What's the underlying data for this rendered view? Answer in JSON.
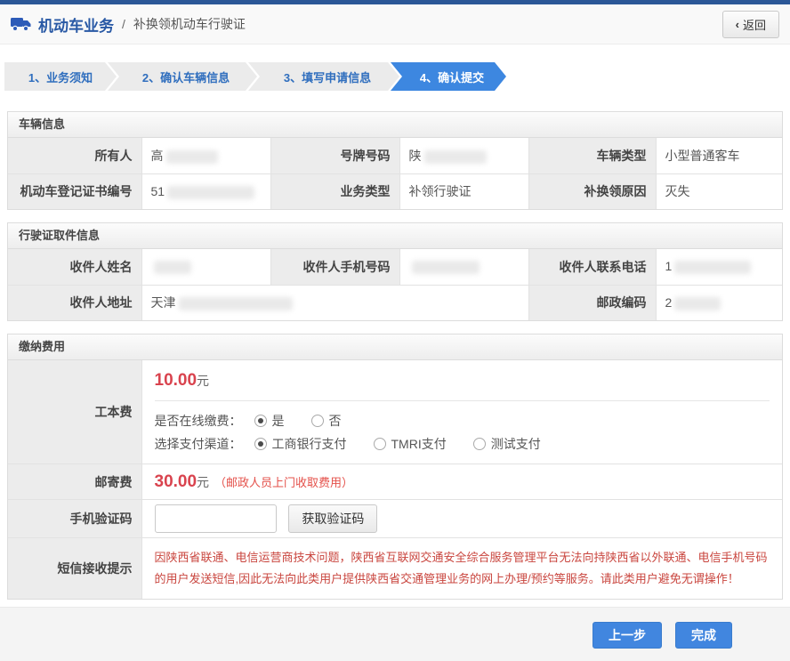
{
  "header": {
    "app_title": "机动车业务",
    "separator": "/",
    "page_title": "补换领机动车行驶证",
    "back_chevron": "‹",
    "back_label": "返回"
  },
  "steps": [
    {
      "label": "1、业务须知",
      "active": false
    },
    {
      "label": "2、确认车辆信息",
      "active": false
    },
    {
      "label": "3、填写申请信息",
      "active": false
    },
    {
      "label": "4、确认提交",
      "active": true
    }
  ],
  "vehicle_info": {
    "title": "车辆信息",
    "row1": {
      "owner_label": "所有人",
      "owner_value": "高",
      "plate_label": "号牌号码",
      "plate_value": "陕",
      "type_label": "车辆类型",
      "type_value": "小型普通客车"
    },
    "row2": {
      "cert_label": "机动车登记证书编号",
      "cert_value": "51",
      "biz_label": "业务类型",
      "biz_value": "补领行驶证",
      "reason_label": "补换领原因",
      "reason_value": "灭失"
    }
  },
  "pickup_info": {
    "title": "行驶证取件信息",
    "row1": {
      "name_label": "收件人姓名",
      "name_value": "",
      "mobile_label": "收件人手机号码",
      "mobile_value": "",
      "phone_label": "收件人联系电话",
      "phone_value": "1"
    },
    "row2": {
      "address_label": "收件人地址",
      "address_value": "天津",
      "postcode_label": "邮政编码",
      "postcode_value": "2"
    }
  },
  "fees": {
    "title": "缴纳费用",
    "production_fee": {
      "label": "工本费",
      "amount": "10.00",
      "unit": "元",
      "online_question": "是否在线缴费：",
      "online_options": [
        {
          "label": "是",
          "selected": true
        },
        {
          "label": "否",
          "selected": false
        }
      ],
      "channel_question": "选择支付渠道：",
      "channel_options": [
        {
          "label": "工商银行支付",
          "selected": true
        },
        {
          "label": "TMRI支付",
          "selected": false
        },
        {
          "label": "测试支付",
          "selected": false
        }
      ]
    },
    "postage_fee": {
      "label": "邮寄费",
      "amount": "30.00",
      "unit": "元",
      "note": "（邮政人员上门收取费用）"
    },
    "captcha": {
      "label": "手机验证码",
      "input_value": "",
      "button_label": "获取验证码"
    },
    "sms_notice": {
      "label": "短信接收提示",
      "text": "因陕西省联通、电信运营商技术问题，陕西省互联网交通安全综合服务管理平台无法向持陕西省以外联通、电信手机号码的用户发送短信,因此无法向此类用户提供陕西省交通管理业务的网上办理/预约等服务。请此类用户避免无谓操作！"
    }
  },
  "footer": {
    "prev_label": "上一步",
    "done_label": "完成"
  },
  "colors": {
    "top_bar": "#2b5797",
    "accent_blue": "#3d87e0",
    "step_text_blue": "#2f6ebe",
    "fee_red": "#d9434e",
    "notice_red": "#c9453e"
  }
}
